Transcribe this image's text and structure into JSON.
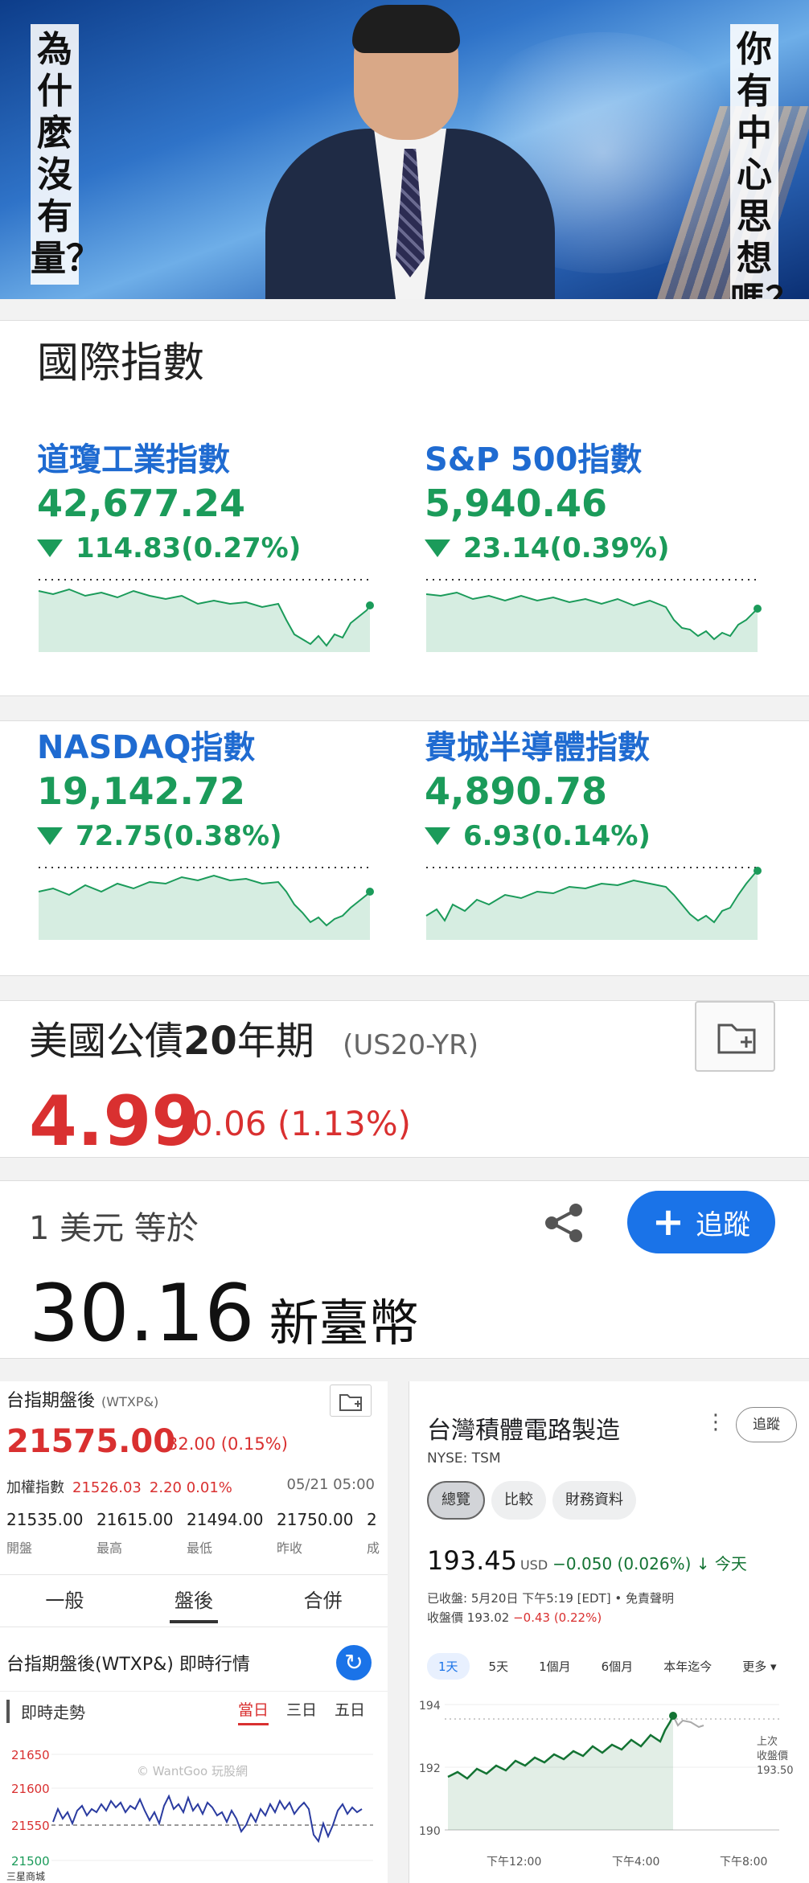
{
  "video": {
    "left_caption": "為什麼沒有量？",
    "right_caption": "你有中心思想嗎？"
  },
  "international": {
    "title": "國際指數",
    "indices": [
      {
        "name": "道瓊工業指數",
        "price": "42,677.24",
        "change": "114.83(0.27%)",
        "direction": "down"
      },
      {
        "name": "S&P 500指數",
        "price": "5,940.46",
        "change": "23.14(0.39%)",
        "direction": "down"
      },
      {
        "name": "NASDAQ指數",
        "price": "19,142.72",
        "change": "72.75(0.38%)",
        "direction": "down"
      },
      {
        "name": "費城半導體指數",
        "price": "4,890.78",
        "change": "6.93(0.14%)",
        "direction": "down"
      }
    ]
  },
  "colors": {
    "down_green": "#1b9b5a",
    "up_red": "#d93030",
    "link_blue": "#1a73e8"
  },
  "bond": {
    "title_pre": "美國公債",
    "title_bold": "20",
    "title_post": "年期",
    "code": "(US20-YR)",
    "price": "4.99",
    "change": "0.06 (1.13%)"
  },
  "fx": {
    "label": "1 美元 等於",
    "follow_label": "追蹤",
    "value": "30.16",
    "unit": "新臺幣"
  },
  "futures": {
    "title": "台指期盤後",
    "code": "(WTXP&)",
    "price": "21575.00",
    "change": "32.00 (0.15%)",
    "index_label": "加權指數",
    "index_value": "21526.03",
    "index_change": "2.20 0.01%",
    "datetime": "05/21 05:00",
    "stats": [
      {
        "value": "21535.00",
        "label": "開盤"
      },
      {
        "value": "21615.00",
        "label": "最高"
      },
      {
        "value": "21494.00",
        "label": "最低"
      },
      {
        "value": "21750.00",
        "label": "昨收"
      },
      {
        "value": "2",
        "label": "成"
      }
    ],
    "tabs": [
      "一般",
      "盤後",
      "合併"
    ],
    "active_tab": 1,
    "realtime_title": "台指期盤後(WTXP&) 即時行情",
    "trend_label": "即時走勢",
    "periods": [
      "當日",
      "三日",
      "五日"
    ],
    "active_period": 0,
    "y_ticks": [
      "21650",
      "21600",
      "21550",
      "21500"
    ],
    "watermark": "© WantGoo 玩股網",
    "footer": "三星商城"
  },
  "tsm": {
    "name": "台灣積體電路製造",
    "more": "⋮",
    "follow_label": "追蹤",
    "exchange": "NYSE: TSM",
    "tabs": [
      "總覽",
      "比較",
      "財務資料"
    ],
    "active_tab": 0,
    "price": "193.45",
    "currency": "USD",
    "change": "−0.050 (0.026%) ↓ 今天",
    "closed_line": "已收盤: 5月20日 下午5:19 [EDT] • 免責聲明",
    "close_label": "收盤價",
    "close_value": "193.02",
    "close_change": "−0.43 (0.22%)",
    "ranges": [
      "1天",
      "5天",
      "1個月",
      "6個月",
      "本年迄今",
      "更多 ▾"
    ],
    "active_range": 0,
    "y_ticks": [
      "194",
      "192",
      "190"
    ],
    "x_ticks": [
      "下午12:00",
      "下午4:00",
      "下午8:00"
    ],
    "prev_close_label_1": "上次",
    "prev_close_label_2": "收盤價",
    "prev_close_value": "193.50"
  }
}
